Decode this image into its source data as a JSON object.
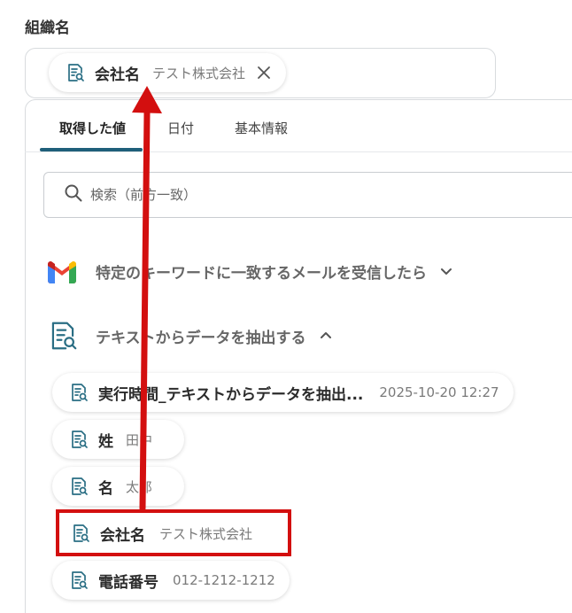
{
  "field": {
    "label": "組織名"
  },
  "selected_chip": {
    "key": "会社名",
    "value": "テスト株式会社"
  },
  "tabs": [
    {
      "label": "取得した値",
      "active": true
    },
    {
      "label": "日付",
      "active": false
    },
    {
      "label": "基本情報",
      "active": false
    }
  ],
  "search": {
    "placeholder": "検索（前方一致）"
  },
  "sections": {
    "gmail": {
      "title": "特定のキーワードに一致するメールを受信したら",
      "state": "collapsed"
    },
    "extract": {
      "title": "テキストからデータを抽出する",
      "state": "expanded"
    }
  },
  "items": [
    {
      "key": "実行時間_テキストからデータを抽出...",
      "value": "2025-10-20 12:27"
    },
    {
      "key": "姓",
      "value": "田中"
    },
    {
      "key": "名",
      "value": "太郎"
    },
    {
      "key": "会社名",
      "value": "テスト株式会社"
    },
    {
      "key": "電話番号",
      "value": "012-1212-1212"
    }
  ],
  "colors": {
    "accent": "#1f5f7a",
    "highlight": "#d30f0f",
    "icon_teal": "#2a6e84"
  }
}
